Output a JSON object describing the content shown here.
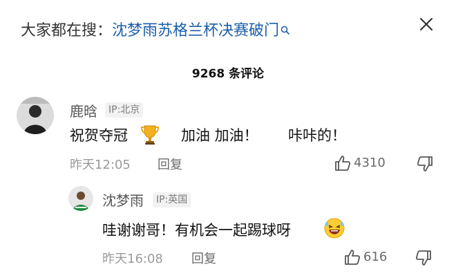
{
  "header": {
    "prefix": "大家都在搜：",
    "query": "沈梦雨苏格兰杯决赛破门"
  },
  "comment_count_label": "9268 条评论",
  "comments": [
    {
      "username": "鹿晗",
      "ip": "IP:北京",
      "text_part1": "祝贺夺冠",
      "text_part2": "加油 加油！",
      "text_part3": "咔咔的！",
      "time": "昨天12:05",
      "reply_label": "回复",
      "likes": "4310"
    },
    {
      "username": "沈梦雨",
      "ip": "IP:英国",
      "text": "哇谢谢哥！有机会一起踢球呀",
      "time": "昨天16:08",
      "reply_label": "回复",
      "likes": "616"
    }
  ]
}
